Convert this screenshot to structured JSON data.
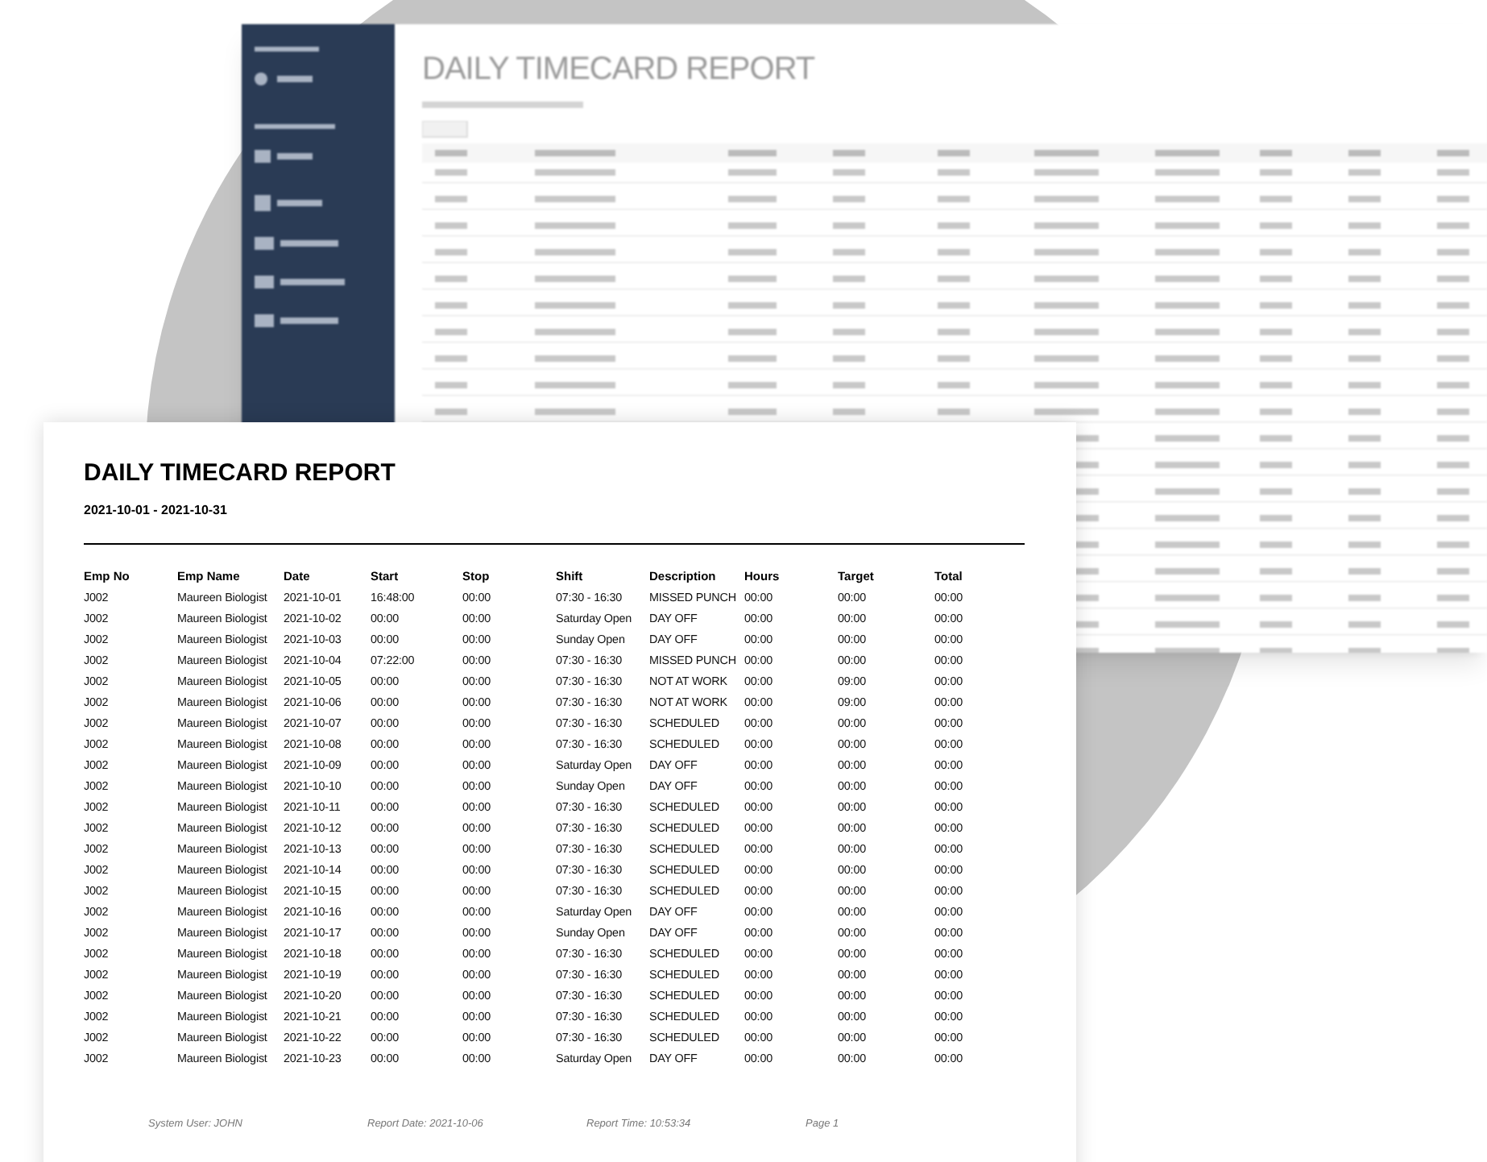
{
  "background_window": {
    "title": "DAILY TIMECARD REPORT"
  },
  "report": {
    "title": "DAILY TIMECARD REPORT",
    "date_range": "2021-10-01 - 2021-10-31",
    "columns": [
      "Emp No",
      "Emp Name",
      "Date",
      "Start",
      "Stop",
      "Shift",
      "Description",
      "Hours",
      "Target",
      "Total"
    ],
    "rows": [
      [
        "J002",
        "Maureen Biologist",
        "2021-10-01",
        "16:48:00",
        "00:00",
        "07:30 - 16:30",
        "MISSED PUNCH",
        "00:00",
        "00:00",
        "00:00"
      ],
      [
        "J002",
        "Maureen Biologist",
        "2021-10-02",
        "00:00",
        "00:00",
        "Saturday Open",
        "DAY OFF",
        "00:00",
        "00:00",
        "00:00"
      ],
      [
        "J002",
        "Maureen Biologist",
        "2021-10-03",
        "00:00",
        "00:00",
        "Sunday Open",
        "DAY OFF",
        "00:00",
        "00:00",
        "00:00"
      ],
      [
        "J002",
        "Maureen Biologist",
        "2021-10-04",
        "07:22:00",
        "00:00",
        "07:30 - 16:30",
        "MISSED PUNCH",
        "00:00",
        "00:00",
        "00:00"
      ],
      [
        "J002",
        "Maureen Biologist",
        "2021-10-05",
        "00:00",
        "00:00",
        "07:30 - 16:30",
        "NOT AT WORK",
        "00:00",
        "09:00",
        "00:00"
      ],
      [
        "J002",
        "Maureen Biologist",
        "2021-10-06",
        "00:00",
        "00:00",
        "07:30 - 16:30",
        "NOT AT WORK",
        "00:00",
        "09:00",
        "00:00"
      ],
      [
        "J002",
        "Maureen Biologist",
        "2021-10-07",
        "00:00",
        "00:00",
        "07:30 - 16:30",
        "SCHEDULED",
        "00:00",
        "00:00",
        "00:00"
      ],
      [
        "J002",
        "Maureen Biologist",
        "2021-10-08",
        "00:00",
        "00:00",
        "07:30 - 16:30",
        "SCHEDULED",
        "00:00",
        "00:00",
        "00:00"
      ],
      [
        "J002",
        "Maureen Biologist",
        "2021-10-09",
        "00:00",
        "00:00",
        "Saturday Open",
        "DAY OFF",
        "00:00",
        "00:00",
        "00:00"
      ],
      [
        "J002",
        "Maureen Biologist",
        "2021-10-10",
        "00:00",
        "00:00",
        "Sunday Open",
        "DAY OFF",
        "00:00",
        "00:00",
        "00:00"
      ],
      [
        "J002",
        "Maureen Biologist",
        "2021-10-11",
        "00:00",
        "00:00",
        "07:30 - 16:30",
        "SCHEDULED",
        "00:00",
        "00:00",
        "00:00"
      ],
      [
        "J002",
        "Maureen Biologist",
        "2021-10-12",
        "00:00",
        "00:00",
        "07:30 - 16:30",
        "SCHEDULED",
        "00:00",
        "00:00",
        "00:00"
      ],
      [
        "J002",
        "Maureen Biologist",
        "2021-10-13",
        "00:00",
        "00:00",
        "07:30 - 16:30",
        "SCHEDULED",
        "00:00",
        "00:00",
        "00:00"
      ],
      [
        "J002",
        "Maureen Biologist",
        "2021-10-14",
        "00:00",
        "00:00",
        "07:30 - 16:30",
        "SCHEDULED",
        "00:00",
        "00:00",
        "00:00"
      ],
      [
        "J002",
        "Maureen Biologist",
        "2021-10-15",
        "00:00",
        "00:00",
        "07:30 - 16:30",
        "SCHEDULED",
        "00:00",
        "00:00",
        "00:00"
      ],
      [
        "J002",
        "Maureen Biologist",
        "2021-10-16",
        "00:00",
        "00:00",
        "Saturday Open",
        "DAY OFF",
        "00:00",
        "00:00",
        "00:00"
      ],
      [
        "J002",
        "Maureen Biologist",
        "2021-10-17",
        "00:00",
        "00:00",
        "Sunday Open",
        "DAY OFF",
        "00:00",
        "00:00",
        "00:00"
      ],
      [
        "J002",
        "Maureen Biologist",
        "2021-10-18",
        "00:00",
        "00:00",
        "07:30 - 16:30",
        "SCHEDULED",
        "00:00",
        "00:00",
        "00:00"
      ],
      [
        "J002",
        "Maureen Biologist",
        "2021-10-19",
        "00:00",
        "00:00",
        "07:30 - 16:30",
        "SCHEDULED",
        "00:00",
        "00:00",
        "00:00"
      ],
      [
        "J002",
        "Maureen Biologist",
        "2021-10-20",
        "00:00",
        "00:00",
        "07:30 - 16:30",
        "SCHEDULED",
        "00:00",
        "00:00",
        "00:00"
      ],
      [
        "J002",
        "Maureen Biologist",
        "2021-10-21",
        "00:00",
        "00:00",
        "07:30 - 16:30",
        "SCHEDULED",
        "00:00",
        "00:00",
        "00:00"
      ],
      [
        "J002",
        "Maureen Biologist",
        "2021-10-22",
        "00:00",
        "00:00",
        "07:30 - 16:30",
        "SCHEDULED",
        "00:00",
        "00:00",
        "00:00"
      ],
      [
        "J002",
        "Maureen Biologist",
        "2021-10-23",
        "00:00",
        "00:00",
        "Saturday Open",
        "DAY OFF",
        "00:00",
        "00:00",
        "00:00"
      ]
    ],
    "footer": [
      "System User: JOHN",
      "Report Date: 2021-10-06",
      "Report Time: 10:53:34",
      "Page 1"
    ]
  }
}
